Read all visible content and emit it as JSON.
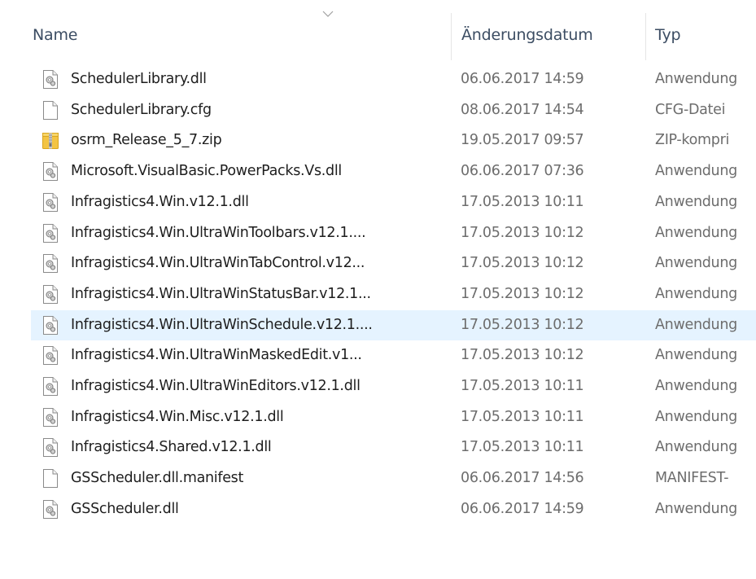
{
  "header": {
    "name": "Name",
    "date": "Änderungsdatum",
    "type": "Typ"
  },
  "files": [
    {
      "name": "SchedulerLibrary.dll",
      "date": "06.06.2017 14:59",
      "type": "Anwendung",
      "icon": "dll-icon"
    },
    {
      "name": "SchedulerLibrary.cfg",
      "date": "08.06.2017 14:54",
      "type": "CFG-Datei",
      "icon": "blank-file-icon"
    },
    {
      "name": "osrm_Release_5_7.zip",
      "date": "19.05.2017 09:57",
      "type": "ZIP-kompri",
      "icon": "zip-folder-icon"
    },
    {
      "name": "Microsoft.VisualBasic.PowerPacks.Vs.dll",
      "date": "06.06.2017 07:36",
      "type": "Anwendung",
      "icon": "dll-icon"
    },
    {
      "name": "Infragistics4.Win.v12.1.dll",
      "date": "17.05.2013 10:11",
      "type": "Anwendung",
      "icon": "dll-icon"
    },
    {
      "name": "Infragistics4.Win.UltraWinToolbars.v12.1....",
      "date": "17.05.2013 10:12",
      "type": "Anwendung",
      "icon": "dll-icon"
    },
    {
      "name": "Infragistics4.Win.UltraWinTabControl.v12...",
      "date": "17.05.2013 10:12",
      "type": "Anwendung",
      "icon": "dll-icon"
    },
    {
      "name": "Infragistics4.Win.UltraWinStatusBar.v12.1...",
      "date": "17.05.2013 10:12",
      "type": "Anwendung",
      "icon": "dll-icon"
    },
    {
      "name": "Infragistics4.Win.UltraWinSchedule.v12.1....",
      "date": "17.05.2013 10:12",
      "type": "Anwendung",
      "icon": "dll-icon",
      "selected": true
    },
    {
      "name": "Infragistics4.Win.UltraWinMaskedEdit.v1...",
      "date": "17.05.2013 10:12",
      "type": "Anwendung",
      "icon": "dll-icon"
    },
    {
      "name": "Infragistics4.Win.UltraWinEditors.v12.1.dll",
      "date": "17.05.2013 10:11",
      "type": "Anwendung",
      "icon": "dll-icon"
    },
    {
      "name": "Infragistics4.Win.Misc.v12.1.dll",
      "date": "17.05.2013 10:11",
      "type": "Anwendung",
      "icon": "dll-icon"
    },
    {
      "name": "Infragistics4.Shared.v12.1.dll",
      "date": "17.05.2013 10:11",
      "type": "Anwendung",
      "icon": "dll-icon"
    },
    {
      "name": "GSScheduler.dll.manifest",
      "date": "06.06.2017 14:56",
      "type": "MANIFEST-",
      "icon": "blank-file-icon"
    },
    {
      "name": "GSScheduler.dll",
      "date": "06.06.2017 14:59",
      "type": "Anwendung",
      "icon": "dll-icon"
    }
  ],
  "colors": {
    "selected_row": "#e5f3ff",
    "header_text": "#3c4d63",
    "secondary_text": "#6d6d6d"
  }
}
